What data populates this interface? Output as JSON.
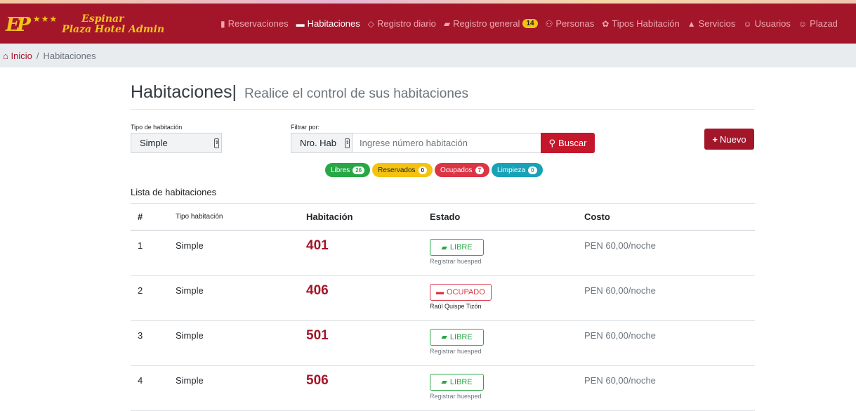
{
  "brand": {
    "logo": "EP",
    "stars": "★★★",
    "line1": "Espinar",
    "line2": "Plaza Hotel Admin"
  },
  "nav": [
    {
      "label": "Reservaciones",
      "icon": "bookmark-icon",
      "active": false
    },
    {
      "label": "Habitaciones",
      "icon": "bed-icon",
      "active": true
    },
    {
      "label": "Registro diario",
      "icon": "diamond-icon",
      "active": false
    },
    {
      "label": "Registro general",
      "icon": "book-icon",
      "active": false,
      "badge": "14"
    },
    {
      "label": "Personas",
      "icon": "users-icon",
      "active": false
    },
    {
      "label": "Tipos Habitación",
      "icon": "gift-icon",
      "active": false
    },
    {
      "label": "Servicios",
      "icon": "bell-icon",
      "active": false
    },
    {
      "label": "Usuarios",
      "icon": "user-circle-icon",
      "active": false
    },
    {
      "label": "Plazad",
      "icon": "user-circle-icon",
      "active": false
    }
  ],
  "breadcrumb": {
    "home": "Inicio",
    "separator": "/",
    "current": "Habitaciones"
  },
  "page": {
    "title": "Habitaciones|",
    "subtitle": "Realice el control de sus habitaciones"
  },
  "filters": {
    "tipo_label": "Tipo de habitación",
    "tipo_value": "Simple",
    "filtrar_label": "Filtrar por:",
    "filtrar_value": "Nro. Hab",
    "search_placeholder": "Ingrese número habitación",
    "search_button": "Buscar",
    "new_button": "Nuevo"
  },
  "status_pills": [
    {
      "label": "Libres",
      "count": "26",
      "color": "#28a745"
    },
    {
      "label": "Reservados",
      "count": "0",
      "color": "#f5c211"
    },
    {
      "label": "Ocupados",
      "count": "7",
      "color": "#dc3545"
    },
    {
      "label": "Limpieza",
      "count": "0",
      "color": "#17a2b8"
    }
  ],
  "list": {
    "title": "Lista de habitaciones",
    "headers": [
      "#",
      "Tipo habitación",
      "Habitación",
      "Estado",
      "Costo"
    ],
    "rows": [
      {
        "num": "1",
        "tipo": "Simple",
        "room": "401",
        "estado": "LIBRE",
        "estado_kind": "libre",
        "sub": "Registrar huesped",
        "costo": "PEN 60,00/noche"
      },
      {
        "num": "2",
        "tipo": "Simple",
        "room": "406",
        "estado": "OCUPADO",
        "estado_kind": "ocupado",
        "sub": "Raúl Quispe Tizón",
        "costo": "PEN 60,00/noche"
      },
      {
        "num": "3",
        "tipo": "Simple",
        "room": "501",
        "estado": "LIBRE",
        "estado_kind": "libre",
        "sub": "Registrar huesped",
        "costo": "PEN 60,00/noche"
      },
      {
        "num": "4",
        "tipo": "Simple",
        "room": "506",
        "estado": "LIBRE",
        "estado_kind": "libre",
        "sub": "Registrar huesped",
        "costo": "PEN 60,00/noche"
      }
    ]
  },
  "colors": {
    "brand": "#a3162a",
    "gold": "#f3c318",
    "button": "#c4172c"
  }
}
